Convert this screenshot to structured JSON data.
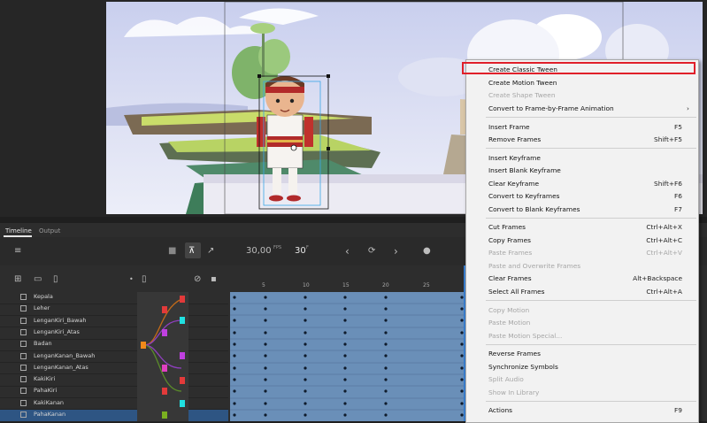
{
  "timeline": {
    "tabs": [
      "Timeline",
      "Output"
    ],
    "fps": "30,00",
    "fps_unit": "FPS",
    "frame": "30",
    "frame_unit": "F",
    "ruler_ticks": [
      "5",
      "10",
      "15",
      "20",
      "25"
    ],
    "layers": [
      "Kepala",
      "Leher",
      "LenganKiri_Bawah",
      "LenganKiri_Atas",
      "Badan",
      "LenganKanan_Bawah",
      "LenganKanan_Atas",
      "KakiKiri",
      "PahaKiri",
      "KakiKanan",
      "PahaKanan"
    ],
    "selected_layer": "PahaKanan"
  },
  "context_menu": {
    "items": [
      {
        "label": "Create Classic Tween",
        "shortcut": "",
        "enabled": true,
        "highlighted": true
      },
      {
        "label": "Create Motion Tween",
        "shortcut": "",
        "enabled": true
      },
      {
        "label": "Create Shape Tween",
        "shortcut": "",
        "enabled": false
      },
      {
        "label": "Convert to Frame-by-Frame Animation",
        "shortcut": "›",
        "enabled": true
      },
      {
        "label": "Insert Frame",
        "shortcut": "F5",
        "enabled": true
      },
      {
        "label": "Remove Frames",
        "shortcut": "Shift+F5",
        "enabled": true
      },
      {
        "label": "Insert Keyframe",
        "shortcut": "",
        "enabled": true
      },
      {
        "label": "Insert Blank Keyframe",
        "shortcut": "",
        "enabled": true
      },
      {
        "label": "Clear Keyframe",
        "shortcut": "Shift+F6",
        "enabled": true
      },
      {
        "label": "Convert to Keyframes",
        "shortcut": "F6",
        "enabled": true
      },
      {
        "label": "Convert to Blank Keyframes",
        "shortcut": "F7",
        "enabled": true
      },
      {
        "label": "Cut Frames",
        "shortcut": "Ctrl+Alt+X",
        "enabled": true
      },
      {
        "label": "Copy Frames",
        "shortcut": "Ctrl+Alt+C",
        "enabled": true
      },
      {
        "label": "Paste Frames",
        "shortcut": "Ctrl+Alt+V",
        "enabled": false
      },
      {
        "label": "Paste and Overwrite Frames",
        "shortcut": "",
        "enabled": false
      },
      {
        "label": "Clear Frames",
        "shortcut": "Alt+Backspace",
        "enabled": true
      },
      {
        "label": "Select All Frames",
        "shortcut": "Ctrl+Alt+A",
        "enabled": true
      },
      {
        "label": "Copy Motion",
        "shortcut": "",
        "enabled": false
      },
      {
        "label": "Paste Motion",
        "shortcut": "",
        "enabled": false
      },
      {
        "label": "Paste Motion Special...",
        "shortcut": "",
        "enabled": false
      },
      {
        "label": "Reverse Frames",
        "shortcut": "",
        "enabled": true
      },
      {
        "label": "Synchronize Symbols",
        "shortcut": "",
        "enabled": true
      },
      {
        "label": "Split Audio",
        "shortcut": "",
        "enabled": false
      },
      {
        "label": "Show In Library",
        "shortcut": "",
        "enabled": false
      },
      {
        "label": "Actions",
        "shortcut": "F9",
        "enabled": true
      }
    ]
  },
  "colors": {
    "highlight_box": "#e0202a",
    "selected_layer": "#2e5583",
    "frames": "#6a8fb8",
    "menu_bg": "#f2f2f2",
    "sky": "#c9cfee"
  },
  "icons": [
    "layers-icon",
    "camera-icon",
    "parenting-icon",
    "graph-icon",
    "prev-frame-icon",
    "loop-icon",
    "next-frame-icon",
    "onion-skin-icon",
    "new-layer-icon",
    "new-folder-icon",
    "delete-icon",
    "visibility-icon",
    "lock-icon"
  ]
}
